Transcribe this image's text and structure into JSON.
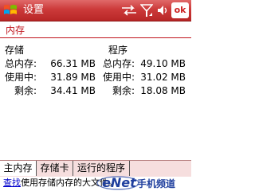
{
  "titlebar": {
    "title": "设置",
    "ok_label": "ok"
  },
  "page": {
    "title": "内存"
  },
  "memory": {
    "storage": {
      "heading": "存储",
      "rows": [
        {
          "label": "总内存:",
          "value": "66.31 MB"
        },
        {
          "label": "使用中:",
          "value": "31.89 MB"
        },
        {
          "label": "剩余:",
          "value": "34.41 MB"
        }
      ]
    },
    "program": {
      "heading": "程序",
      "rows": [
        {
          "label": "总内存:",
          "value": "49.10 MB"
        },
        {
          "label": "使用中:",
          "value": "31.02 MB"
        },
        {
          "label": "剩余:",
          "value": "18.08 MB"
        }
      ]
    }
  },
  "tabs": [
    {
      "label": "主内存",
      "active": true
    },
    {
      "label": "存储卡",
      "active": false
    },
    {
      "label": "运行的程序",
      "active": false
    }
  ],
  "hint": {
    "link": "查找",
    "text": "使用存储内存的大文件。"
  },
  "watermark": {
    "brand": "eNet",
    "sub": "手机频道"
  },
  "colors": {
    "titlebar": "#cc3a3a",
    "accent": "#c0141c",
    "tab_bg": "#f6dede"
  }
}
